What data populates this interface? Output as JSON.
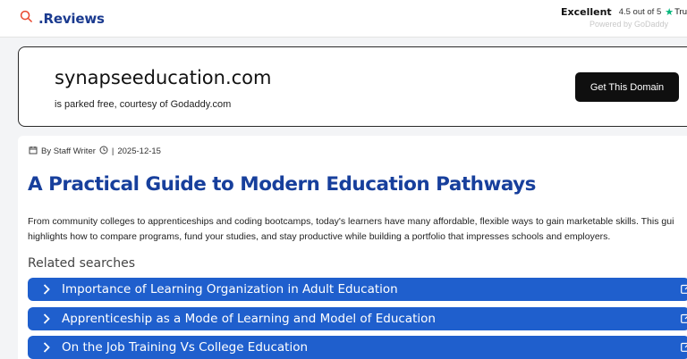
{
  "header": {
    "logo_text": ".Reviews",
    "trust_excellent": "Excellent",
    "trust_score": "4.5 out of 5",
    "trust_brand": "Trustpi",
    "trust_powered": "Powered by GoDaddy"
  },
  "parked": {
    "domain": "synapseeducation.com",
    "subtitle": "is parked free, courtesy of Godaddy.com",
    "button_label": "Get This Domain"
  },
  "article": {
    "author": "By Staff Writer",
    "separator": "|",
    "date": "2025-12-15",
    "headline": "A Practical Guide to Modern Education Pathways",
    "summary_line1": "From community colleges to apprenticeships and coding bootcamps, today's learners have many affordable, flexible ways to gain marketable skills. This gui",
    "summary_line2": "highlights how to compare programs, fund your studies, and stay productive while building a portfolio that impresses schools and employers."
  },
  "related": {
    "title": "Related searches",
    "items": [
      "Importance of Learning Organization in Adult Education",
      "Apprenticeship as a Mode of Learning and Model of Education",
      "On the Job Training Vs College Education"
    ]
  },
  "colors": {
    "brand_blue": "#1a3a8f",
    "headline_blue": "#173f9c",
    "related_blue": "#1f5fcd",
    "trust_green": "#00b67a",
    "button_black": "#0f0f0f"
  },
  "icons": [
    "search-icon",
    "star-icon",
    "calendar-icon",
    "clock-icon",
    "chevron-right-icon",
    "external-link-icon"
  ]
}
